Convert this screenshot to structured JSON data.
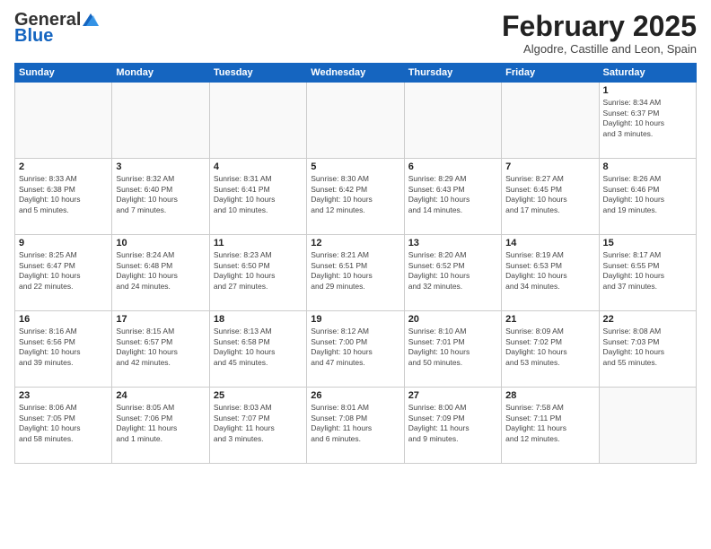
{
  "header": {
    "logo_general": "General",
    "logo_blue": "Blue",
    "month_title": "February 2025",
    "subtitle": "Algodre, Castille and Leon, Spain"
  },
  "days_of_week": [
    "Sunday",
    "Monday",
    "Tuesday",
    "Wednesday",
    "Thursday",
    "Friday",
    "Saturday"
  ],
  "weeks": [
    [
      {
        "day": "",
        "info": ""
      },
      {
        "day": "",
        "info": ""
      },
      {
        "day": "",
        "info": ""
      },
      {
        "day": "",
        "info": ""
      },
      {
        "day": "",
        "info": ""
      },
      {
        "day": "",
        "info": ""
      },
      {
        "day": "1",
        "info": "Sunrise: 8:34 AM\nSunset: 6:37 PM\nDaylight: 10 hours\nand 3 minutes."
      }
    ],
    [
      {
        "day": "2",
        "info": "Sunrise: 8:33 AM\nSunset: 6:38 PM\nDaylight: 10 hours\nand 5 minutes."
      },
      {
        "day": "3",
        "info": "Sunrise: 8:32 AM\nSunset: 6:40 PM\nDaylight: 10 hours\nand 7 minutes."
      },
      {
        "day": "4",
        "info": "Sunrise: 8:31 AM\nSunset: 6:41 PM\nDaylight: 10 hours\nand 10 minutes."
      },
      {
        "day": "5",
        "info": "Sunrise: 8:30 AM\nSunset: 6:42 PM\nDaylight: 10 hours\nand 12 minutes."
      },
      {
        "day": "6",
        "info": "Sunrise: 8:29 AM\nSunset: 6:43 PM\nDaylight: 10 hours\nand 14 minutes."
      },
      {
        "day": "7",
        "info": "Sunrise: 8:27 AM\nSunset: 6:45 PM\nDaylight: 10 hours\nand 17 minutes."
      },
      {
        "day": "8",
        "info": "Sunrise: 8:26 AM\nSunset: 6:46 PM\nDaylight: 10 hours\nand 19 minutes."
      }
    ],
    [
      {
        "day": "9",
        "info": "Sunrise: 8:25 AM\nSunset: 6:47 PM\nDaylight: 10 hours\nand 22 minutes."
      },
      {
        "day": "10",
        "info": "Sunrise: 8:24 AM\nSunset: 6:48 PM\nDaylight: 10 hours\nand 24 minutes."
      },
      {
        "day": "11",
        "info": "Sunrise: 8:23 AM\nSunset: 6:50 PM\nDaylight: 10 hours\nand 27 minutes."
      },
      {
        "day": "12",
        "info": "Sunrise: 8:21 AM\nSunset: 6:51 PM\nDaylight: 10 hours\nand 29 minutes."
      },
      {
        "day": "13",
        "info": "Sunrise: 8:20 AM\nSunset: 6:52 PM\nDaylight: 10 hours\nand 32 minutes."
      },
      {
        "day": "14",
        "info": "Sunrise: 8:19 AM\nSunset: 6:53 PM\nDaylight: 10 hours\nand 34 minutes."
      },
      {
        "day": "15",
        "info": "Sunrise: 8:17 AM\nSunset: 6:55 PM\nDaylight: 10 hours\nand 37 minutes."
      }
    ],
    [
      {
        "day": "16",
        "info": "Sunrise: 8:16 AM\nSunset: 6:56 PM\nDaylight: 10 hours\nand 39 minutes."
      },
      {
        "day": "17",
        "info": "Sunrise: 8:15 AM\nSunset: 6:57 PM\nDaylight: 10 hours\nand 42 minutes."
      },
      {
        "day": "18",
        "info": "Sunrise: 8:13 AM\nSunset: 6:58 PM\nDaylight: 10 hours\nand 45 minutes."
      },
      {
        "day": "19",
        "info": "Sunrise: 8:12 AM\nSunset: 7:00 PM\nDaylight: 10 hours\nand 47 minutes."
      },
      {
        "day": "20",
        "info": "Sunrise: 8:10 AM\nSunset: 7:01 PM\nDaylight: 10 hours\nand 50 minutes."
      },
      {
        "day": "21",
        "info": "Sunrise: 8:09 AM\nSunset: 7:02 PM\nDaylight: 10 hours\nand 53 minutes."
      },
      {
        "day": "22",
        "info": "Sunrise: 8:08 AM\nSunset: 7:03 PM\nDaylight: 10 hours\nand 55 minutes."
      }
    ],
    [
      {
        "day": "23",
        "info": "Sunrise: 8:06 AM\nSunset: 7:05 PM\nDaylight: 10 hours\nand 58 minutes."
      },
      {
        "day": "24",
        "info": "Sunrise: 8:05 AM\nSunset: 7:06 PM\nDaylight: 11 hours\nand 1 minute."
      },
      {
        "day": "25",
        "info": "Sunrise: 8:03 AM\nSunset: 7:07 PM\nDaylight: 11 hours\nand 3 minutes."
      },
      {
        "day": "26",
        "info": "Sunrise: 8:01 AM\nSunset: 7:08 PM\nDaylight: 11 hours\nand 6 minutes."
      },
      {
        "day": "27",
        "info": "Sunrise: 8:00 AM\nSunset: 7:09 PM\nDaylight: 11 hours\nand 9 minutes."
      },
      {
        "day": "28",
        "info": "Sunrise: 7:58 AM\nSunset: 7:11 PM\nDaylight: 11 hours\nand 12 minutes."
      },
      {
        "day": "",
        "info": ""
      }
    ]
  ]
}
